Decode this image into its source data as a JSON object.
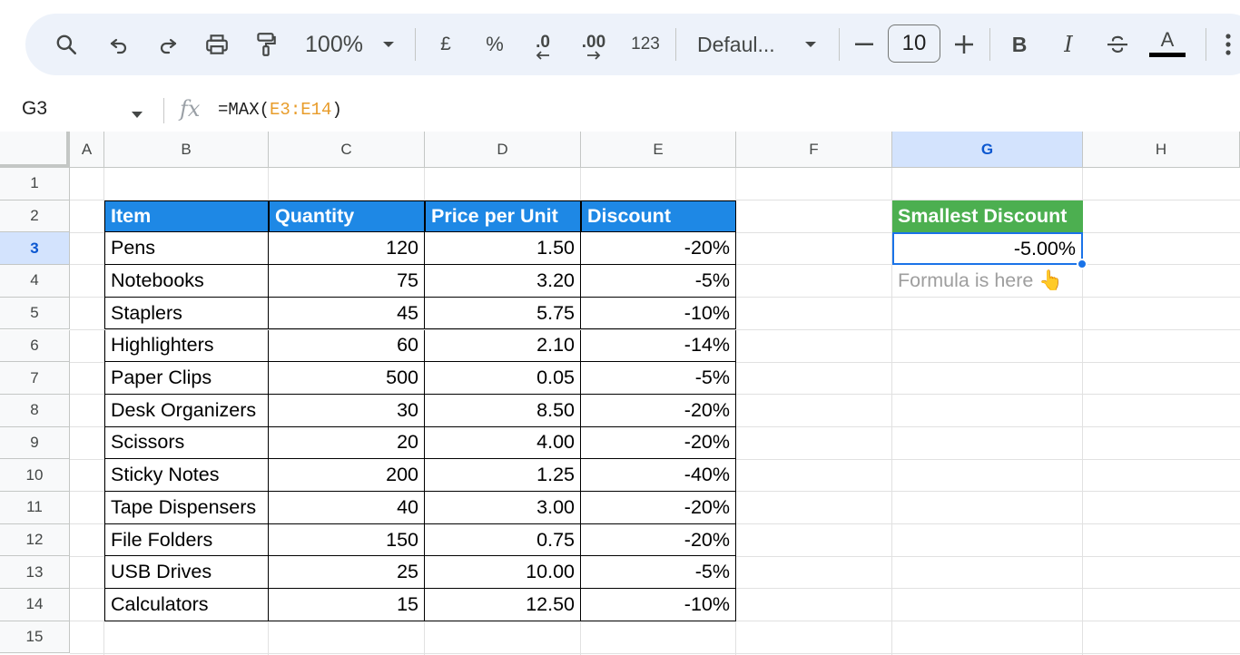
{
  "toolbar": {
    "zoom": "100%",
    "currency": "£",
    "percent": "%",
    "decrease_decimal": ".0",
    "increase_decimal": ".00",
    "more_formats": "123",
    "font_name": "Defaul...",
    "font_size": "10",
    "bold": "B",
    "italic": "I",
    "text_color": "A",
    "icons": [
      "search-icon",
      "undo-icon",
      "redo-icon",
      "print-icon",
      "paint-format-icon",
      "chevron-down-icon",
      "minus-icon",
      "plus-icon",
      "strikethrough-icon",
      "more-vert-icon"
    ]
  },
  "formula_bar": {
    "name_box": "G3",
    "fx": "fx",
    "formula_prefix": "=MAX(",
    "formula_ref": "E3:E14",
    "formula_suffix": ")"
  },
  "columns": [
    "A",
    "B",
    "C",
    "D",
    "E",
    "F",
    "G",
    "H"
  ],
  "active_column": "G",
  "rows": [
    "1",
    "2",
    "3",
    "4",
    "5",
    "6",
    "7",
    "8",
    "9",
    "10",
    "11",
    "12",
    "13",
    "14",
    "15"
  ],
  "active_row": "3",
  "table": {
    "headers": [
      "Item",
      "Quantity",
      "Price per Unit",
      "Discount"
    ],
    "header_color": "#1e88e5",
    "rows": [
      [
        "Pens",
        "120",
        "1.50",
        "-20%"
      ],
      [
        "Notebooks",
        "75",
        "3.20",
        "-5%"
      ],
      [
        "Staplers",
        "45",
        "5.75",
        "-10%"
      ],
      [
        "Highlighters",
        "60",
        "2.10",
        "-14%"
      ],
      [
        "Paper Clips",
        "500",
        "0.05",
        "-5%"
      ],
      [
        "Desk Organizers",
        "30",
        "8.50",
        "-20%"
      ],
      [
        "Scissors",
        "20",
        "4.00",
        "-20%"
      ],
      [
        "Sticky Notes",
        "200",
        "1.25",
        "-40%"
      ],
      [
        "Tape Dispensers",
        "40",
        "3.00",
        "-20%"
      ],
      [
        "File Folders",
        "150",
        "0.75",
        "-20%"
      ],
      [
        "USB Drives",
        "25",
        "10.00",
        "-5%"
      ],
      [
        "Calculators",
        "15",
        "12.50",
        "-10%"
      ]
    ]
  },
  "result": {
    "header": "Smallest Discount",
    "header_color": "#4caf50",
    "value": "-5.00%",
    "hint": "Formula is here 👆"
  }
}
